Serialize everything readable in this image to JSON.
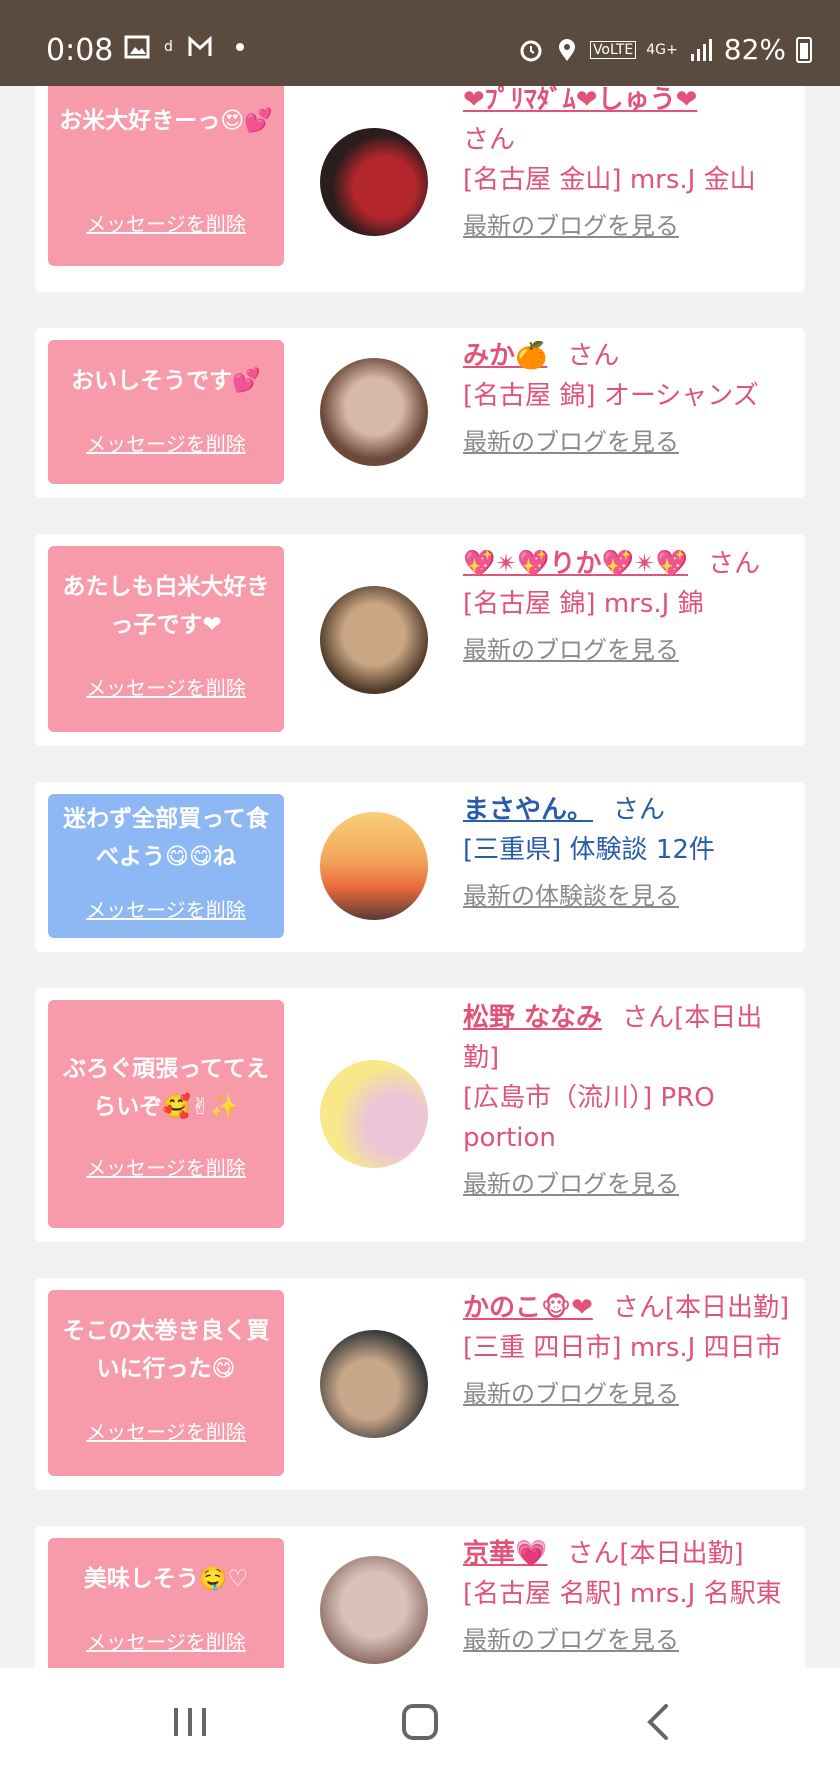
{
  "status": {
    "time": "0:08",
    "battery": "82%",
    "network": "4G+",
    "volte": "VoLTE",
    "notif_icons": [
      "image-icon",
      "dhealth-icon",
      "gmail-icon",
      "dot-icon"
    ],
    "right_icons": [
      "alarm-icon",
      "location-icon",
      "volte-icon",
      "4g-icon",
      "signal-icon",
      "battery-icon"
    ]
  },
  "cards": [
    {
      "message": "お米大好きーっ😍💕",
      "delete": "メッセージを削除",
      "name": "❤ﾌﾟﾘﾏﾀﾞﾑ❤しゅう❤",
      "san": "さん",
      "shop": "[名古屋 金山] mrs.J 金山",
      "link": "最新のブログを見る",
      "bubble": "pink",
      "avatar_colors": [
        "#2b1d1d",
        "#b3262c"
      ]
    },
    {
      "message": "おいしそうです💕",
      "delete": "メッセージを削除",
      "name": "みか🍊",
      "san": "さん",
      "shop": "[名古屋 錦] オーシャンズ",
      "link": "最新のブログを見る",
      "bubble": "pink",
      "avatar_colors": [
        "#6b4a3c",
        "#d8b8a6"
      ]
    },
    {
      "message": "あたしも白米大好きっ子です❤",
      "delete": "メッセージを削除",
      "name": "💖✴💖りか💖✴💖",
      "san": "さん",
      "shop": "[名古屋 錦] mrs.J 錦",
      "link": "最新のブログを見る",
      "bubble": "pink",
      "avatar_colors": [
        "#4e3a2a",
        "#caa684"
      ]
    },
    {
      "message": "迷わず全部買って食べよう😋😋ね",
      "delete": "メッセージを削除",
      "name": "まさやん。",
      "san": "さん",
      "shop": "[三重県] 体験談 12件",
      "link": "最新の体験談を見る",
      "bubble": "blue",
      "avatar_colors": [
        "#f9d07a",
        "#e86a3a"
      ]
    },
    {
      "message": "ぶろぐ頑張っててえらいぞ🥰✌✨",
      "delete": "メッセージを削除",
      "name": "松野 ななみ",
      "san": "さん[本日出勤]",
      "shop": "[広島市（流川）] PRO portion",
      "link": "最新のブログを見る",
      "bubble": "pink",
      "avatar_colors": [
        "#f7e98a",
        "#ecc6d6"
      ]
    },
    {
      "message": "そこの太巻き良く買いに行った😋",
      "delete": "メッセージを削除",
      "name": "かのこ🐵❤",
      "san": "さん[本日出勤]",
      "shop": "[三重 四日市] mrs.J 四日市",
      "link": "最新のブログを見る",
      "bubble": "pink",
      "avatar_colors": [
        "#3a3a3a",
        "#c9a78a"
      ]
    },
    {
      "message": "美味しそう🤤♡",
      "delete": "メッセージを削除",
      "name": "京華💗",
      "san": "さん[本日出勤]",
      "shop": "[名古屋 名駅] mrs.J 名駅東",
      "link": "最新のブログを見る",
      "bubble": "pink",
      "avatar_colors": [
        "#d8c2bb",
        "#8a6a62"
      ]
    }
  ],
  "nav": {
    "icons": [
      "recent-apps-icon",
      "home-icon",
      "back-icon"
    ]
  }
}
